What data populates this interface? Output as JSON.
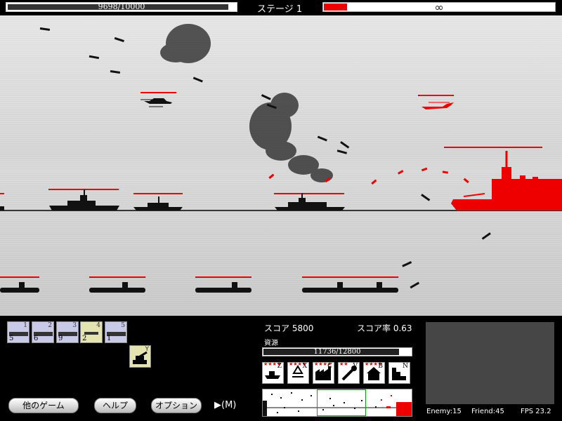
{
  "top": {
    "hp_text": "9698/10000",
    "hp_fraction": 0.97,
    "stage_label": "ステージ 1",
    "enemy_progress_fraction": 0.1,
    "enemy_text": "∞"
  },
  "units": [
    {
      "key": "1",
      "count": "5"
    },
    {
      "key": "2",
      "count": "6"
    },
    {
      "key": "3",
      "count": "9"
    },
    {
      "key": "4",
      "count": "2"
    },
    {
      "key": "5",
      "count": "1"
    }
  ],
  "special_unit_key": "Y",
  "buttons": {
    "other_games": "他のゲーム",
    "help": "ヘルプ",
    "options": "オプション",
    "play_label": "▶(M)"
  },
  "score": {
    "label": "スコア",
    "value": "5800",
    "rate_label": "スコア率",
    "rate_value": "0.63"
  },
  "resources": {
    "label": "資源",
    "text": "11736/12800",
    "fraction": 0.92
  },
  "tools": [
    {
      "key": "Z",
      "stars": "★★★★",
      "icon": "ship-icon"
    },
    {
      "key": "X",
      "stars": "★★★★",
      "icon": "recycle-icon"
    },
    {
      "key": "C",
      "stars": "★★★★",
      "icon": "factory-icon"
    },
    {
      "key": "V",
      "stars": "★★",
      "icon": "wrench-icon"
    },
    {
      "key": "B",
      "stars": "★★★★",
      "icon": "house-icon"
    },
    {
      "key": "N",
      "stars": "",
      "icon": "stairs-icon"
    }
  ],
  "stats": {
    "enemy": "Enemy:15",
    "friend": "Friend:45",
    "fps": "FPS  23.2"
  },
  "colors": {
    "enemy": "#ff0000",
    "friendly": "#111111",
    "hud_bg": "#000000"
  }
}
